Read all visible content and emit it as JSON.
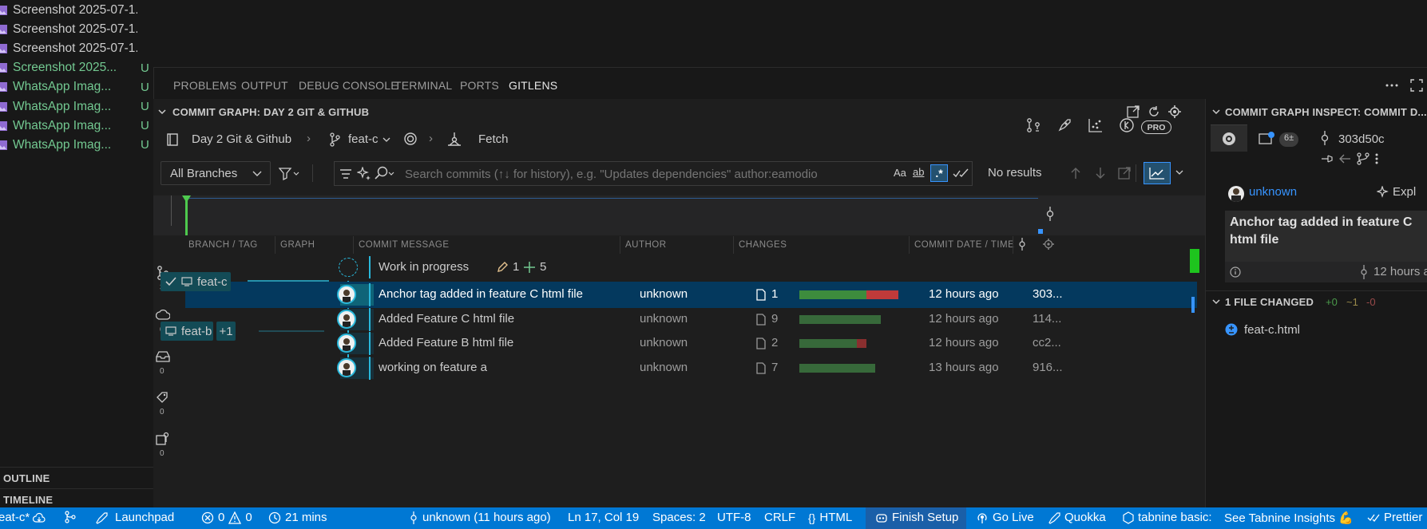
{
  "explorer": {
    "files": [
      {
        "name": "Screenshot 2025-07-1...",
        "badge": "",
        "untracked": false
      },
      {
        "name": "Screenshot 2025-07-1...",
        "badge": "",
        "untracked": false
      },
      {
        "name": "Screenshot 2025-07-1...",
        "badge": "",
        "untracked": false
      },
      {
        "name": "Screenshot 2025...",
        "badge": "U",
        "untracked": true
      },
      {
        "name": "WhatsApp Imag...",
        "badge": "U",
        "untracked": true
      },
      {
        "name": "WhatsApp Imag...",
        "badge": "U",
        "untracked": true
      },
      {
        "name": "WhatsApp Imag...",
        "badge": "U",
        "untracked": true
      },
      {
        "name": "WhatsApp Imag...",
        "badge": "U",
        "untracked": true
      }
    ],
    "outline_label": "OUTLINE",
    "timeline_label": "TIMELINE"
  },
  "panel": {
    "tabs": [
      "PROBLEMS",
      "OUTPUT",
      "DEBUG CONSOLE",
      "TERMINAL",
      "PORTS",
      "GITLENS"
    ],
    "active_tab": "GITLENS"
  },
  "graph": {
    "header": "COMMIT GRAPH: DAY 2 GIT & GITHUB",
    "repo": "Day 2 Git & Github",
    "branch": "feat-c",
    "fetch_label": "Fetch",
    "pro_badge": "PRO",
    "branch_filter": "All Branches",
    "search_placeholder": "Search commits (↑↓ for history), e.g. \"Updates dependencies\" author:eamodio",
    "search_value": "",
    "match_case": "Aa",
    "whole_word": "ab",
    "regex": ".*",
    "no_results": "No results",
    "columns": {
      "branch": "BRANCH / TAG",
      "graph": "GRAPH",
      "message": "COMMIT MESSAGE",
      "author": "AUTHOR",
      "changes": "CHANGES",
      "date": "COMMIT DATE / TIME"
    },
    "side_counts": [
      "3",
      "0",
      "0",
      "0",
      "0"
    ],
    "wip": {
      "message": "Work in progress",
      "modified": "1",
      "added": "5"
    },
    "commits": [
      {
        "message": "Anchor tag added in feature C html file",
        "author": "unknown",
        "files": "1",
        "date": "12 hours ago",
        "sha": "303...",
        "add": 0.68,
        "del": 0.32,
        "selected": true
      },
      {
        "message": "Added Feature C html file",
        "author": "unknown",
        "files": "9",
        "date": "12 hours ago",
        "sha": "114...",
        "add": 0.82,
        "del": 0,
        "selected": false
      },
      {
        "message": "Added Feature B html file",
        "author": "unknown",
        "files": "2",
        "date": "12 hours ago",
        "sha": "cc2...",
        "add": 0.58,
        "del": 0.1,
        "selected": false
      },
      {
        "message": "working on feature a",
        "author": "unknown",
        "files": "7",
        "date": "13 hours ago",
        "sha": "916...",
        "add": 0.77,
        "del": 0,
        "selected": false
      }
    ],
    "branches": {
      "feat_c": "feat-c",
      "feat_b": "feat-b",
      "feat_b_more": "+1"
    }
  },
  "inspect": {
    "header": "COMMIT GRAPH INSPECT: COMMIT D...",
    "stash_count": "6±",
    "sha": "303d50c",
    "author": "unknown",
    "explain": "Expl",
    "message": "Anchor tag added in feature C html file",
    "time": "12 hours a",
    "files_header": "1 FILE CHANGED",
    "stats": {
      "added": "+0",
      "modified": "~1",
      "deleted": "-0"
    },
    "file": "feat-c.html"
  },
  "statusbar": {
    "branch": "eat-c*",
    "launchpad": "Launchpad",
    "errors": "0",
    "warnings": "0",
    "time_spent": "21 mins",
    "blame": "unknown (11 hours ago)",
    "position": "Ln 17, Col 19",
    "spaces": "Spaces: 2",
    "encoding": "UTF-8",
    "eol": "CRLF",
    "language": "HTML",
    "finish_setup": "Finish Setup",
    "go_live": "Go Live",
    "quokka": "Quokka",
    "tabnine": "tabnine basic:",
    "tabnine_insights": "See Tabnine Insights 💪",
    "prettier": "Prettier"
  },
  "colors": {
    "accent": "#0078d4",
    "selected_row": "#04395e",
    "graph_line": "#29b8db",
    "untracked": "#73c991"
  }
}
